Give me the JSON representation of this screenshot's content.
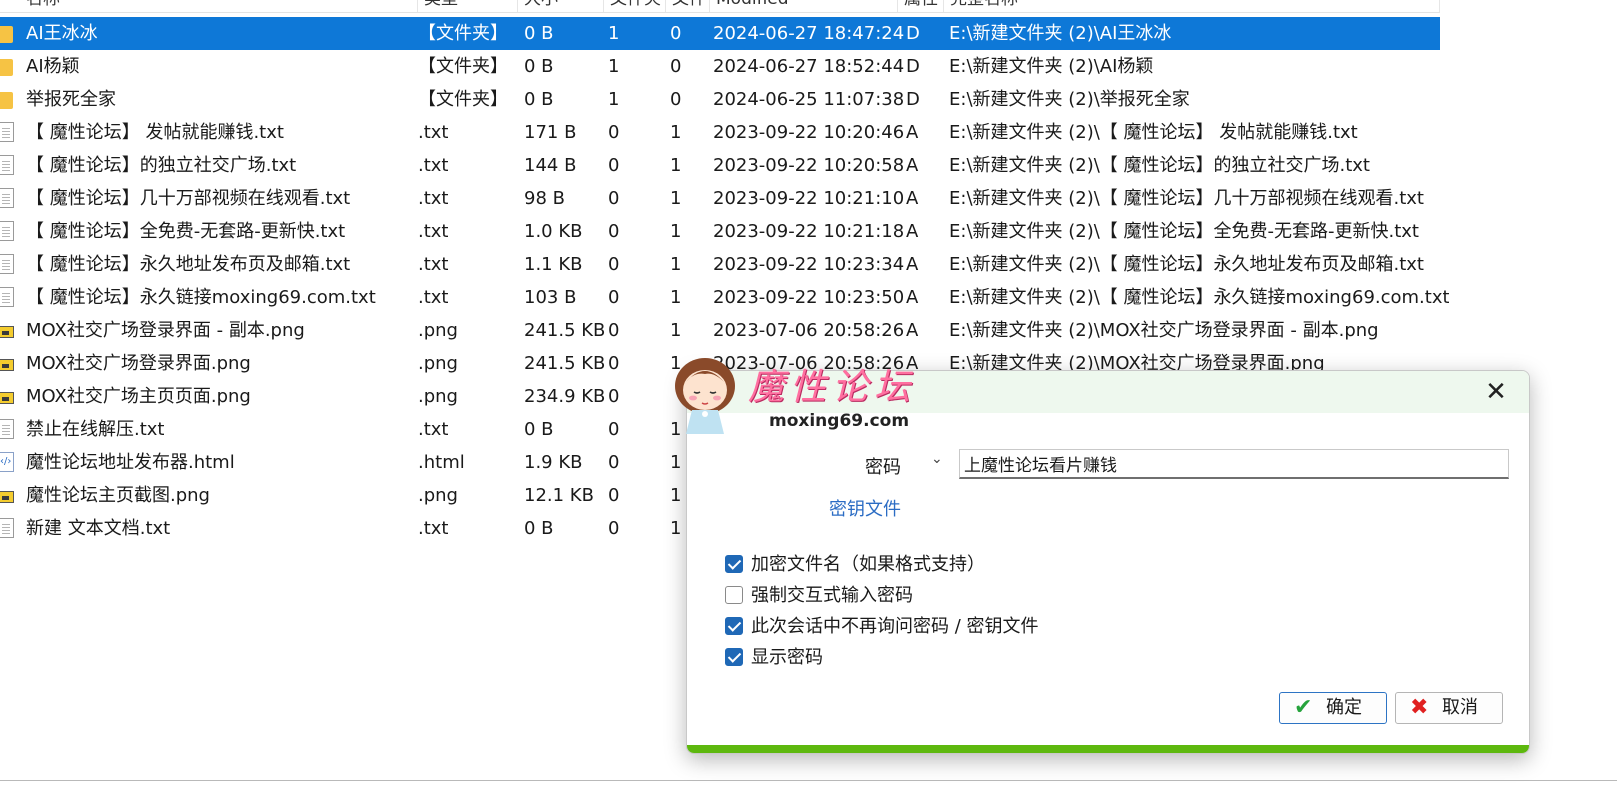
{
  "list_header": {
    "name": "名称",
    "type": "类型",
    "size": "大小",
    "folders": "文件夹",
    "files": "文件",
    "modified": "Modified",
    "attr": "属性",
    "path": "完整名称"
  },
  "rows": [
    {
      "icon": "folder-icon",
      "kind": "folder",
      "name": "AI王冰冰",
      "type": "【文件夹】",
      "size": "0 B",
      "folders": "1",
      "files": "0",
      "modified": "2024-06-27 18:47:24",
      "attr": "D",
      "path": "E:\\新建文件夹 (2)\\AI王冰冰"
    },
    {
      "icon": "folder-icon",
      "kind": "folder",
      "name": "AI杨颖",
      "type": "【文件夹】",
      "size": "0 B",
      "folders": "1",
      "files": "0",
      "modified": "2024-06-27 18:52:44",
      "attr": "D",
      "path": "E:\\新建文件夹 (2)\\AI杨颖"
    },
    {
      "icon": "folder-icon",
      "kind": "folder",
      "name": "举报死全家",
      "type": "【文件夹】",
      "size": "0 B",
      "folders": "1",
      "files": "0",
      "modified": "2024-06-25 11:07:38",
      "attr": "D",
      "path": "E:\\新建文件夹 (2)\\举报死全家"
    },
    {
      "icon": "text-file-icon",
      "kind": "txt",
      "name": "【 魔性论坛】 发帖就能赚钱.txt",
      "type": ".txt",
      "size": "171 B",
      "folders": "0",
      "files": "1",
      "modified": "2023-09-22 10:20:46",
      "attr": "A",
      "path": "E:\\新建文件夹 (2)\\【 魔性论坛】 发帖就能赚钱.txt"
    },
    {
      "icon": "text-file-icon",
      "kind": "txt",
      "name": "【 魔性论坛】的独立社交广场.txt",
      "type": ".txt",
      "size": "144 B",
      "folders": "0",
      "files": "1",
      "modified": "2023-09-22 10:20:58",
      "attr": "A",
      "path": "E:\\新建文件夹 (2)\\【 魔性论坛】的独立社交广场.txt"
    },
    {
      "icon": "text-file-icon",
      "kind": "txt",
      "name": "【 魔性论坛】几十万部视频在线观看.txt",
      "type": ".txt",
      "size": "98 B",
      "folders": "0",
      "files": "1",
      "modified": "2023-09-22 10:21:10",
      "attr": "A",
      "path": "E:\\新建文件夹 (2)\\【 魔性论坛】几十万部视频在线观看.txt"
    },
    {
      "icon": "text-file-icon",
      "kind": "txt",
      "name": "【 魔性论坛】全免费-无套路-更新快.txt",
      "type": ".txt",
      "size": "1.0 KB",
      "folders": "0",
      "files": "1",
      "modified": "2023-09-22 10:21:18",
      "attr": "A",
      "path": "E:\\新建文件夹 (2)\\【 魔性论坛】全免费-无套路-更新快.txt"
    },
    {
      "icon": "text-file-icon",
      "kind": "txt",
      "name": "【 魔性论坛】永久地址发布页及邮箱.txt",
      "type": ".txt",
      "size": "1.1 KB",
      "folders": "0",
      "files": "1",
      "modified": "2023-09-22 10:23:34",
      "attr": "A",
      "path": "E:\\新建文件夹 (2)\\【 魔性论坛】永久地址发布页及邮箱.txt"
    },
    {
      "icon": "text-file-icon",
      "kind": "txt",
      "name": "【 魔性论坛】永久链接moxing69.com.txt",
      "type": ".txt",
      "size": "103 B",
      "folders": "0",
      "files": "1",
      "modified": "2023-09-22 10:23:50",
      "attr": "A",
      "path": "E:\\新建文件夹 (2)\\【 魔性论坛】永久链接moxing69.com.txt"
    },
    {
      "icon": "image-file-icon",
      "kind": "png",
      "name": "MOX社交广场登录界面 - 副本.png",
      "type": ".png",
      "size": "241.5 KB",
      "folders": "0",
      "files": "1",
      "modified": "2023-07-06 20:58:26",
      "attr": "A",
      "path": "E:\\新建文件夹 (2)\\MOX社交广场登录界面 - 副本.png"
    },
    {
      "icon": "image-file-icon",
      "kind": "png",
      "name": "MOX社交广场登录界面.png",
      "type": ".png",
      "size": "241.5 KB",
      "folders": "0",
      "files": "1",
      "modified": "2023-07-06 20:58:26",
      "attr": "A",
      "path": "E:\\新建文件夹 (2)\\MOX社交广场登录界面.png"
    },
    {
      "icon": "image-file-icon",
      "kind": "png",
      "name": "MOX社交广场主页页面.png",
      "type": ".png",
      "size": "234.9 KB",
      "folders": "0",
      "files": "",
      "modified": "",
      "attr": "",
      "path": ""
    },
    {
      "icon": "text-file-icon",
      "kind": "txt",
      "name": "禁止在线解压.txt",
      "type": ".txt",
      "size": "0 B",
      "folders": "0",
      "files": "1",
      "modified": "",
      "attr": "",
      "path": ""
    },
    {
      "icon": "html-file-icon",
      "kind": "html",
      "name": "魔性论坛地址发布器.html",
      "type": ".html",
      "size": "1.9 KB",
      "folders": "0",
      "files": "1",
      "modified": "",
      "attr": "",
      "path": ""
    },
    {
      "icon": "image-file-icon",
      "kind": "png",
      "name": "魔性论坛主页截图.png",
      "type": ".png",
      "size": "12.1 KB",
      "folders": "0",
      "files": "1",
      "modified": "",
      "attr": "",
      "path": ""
    },
    {
      "icon": "text-file-icon",
      "kind": "txt",
      "name": "新建 文本文档.txt",
      "type": ".txt",
      "size": "0 B",
      "folders": "0",
      "files": "1",
      "modified": "",
      "attr": "",
      "path": ""
    }
  ],
  "selected_row": 0,
  "watermark": {
    "brand": "魔性论坛",
    "domain": "moxing69.com"
  },
  "dialog": {
    "password_label": "密码",
    "password_value": "上魔性论坛看片赚钱",
    "keyfile_link": "密钥文件",
    "options": [
      {
        "label": "加密文件名（如果格式支持）",
        "checked": true
      },
      {
        "label": "强制交互式输入密码",
        "checked": false
      },
      {
        "label": "此次会话中不再询问密码 / 密钥文件",
        "checked": true
      },
      {
        "label": "显示密码",
        "checked": true
      }
    ],
    "ok_label": "确定",
    "cancel_label": "取消",
    "close_glyph": "✕",
    "dropdown_glyph": "⌄",
    "progress": 1.0
  },
  "colors": {
    "selection": "#0e78d7",
    "accent": "#1f68b6",
    "progress": "#5db80e",
    "watermark": "#ff6fa0"
  }
}
